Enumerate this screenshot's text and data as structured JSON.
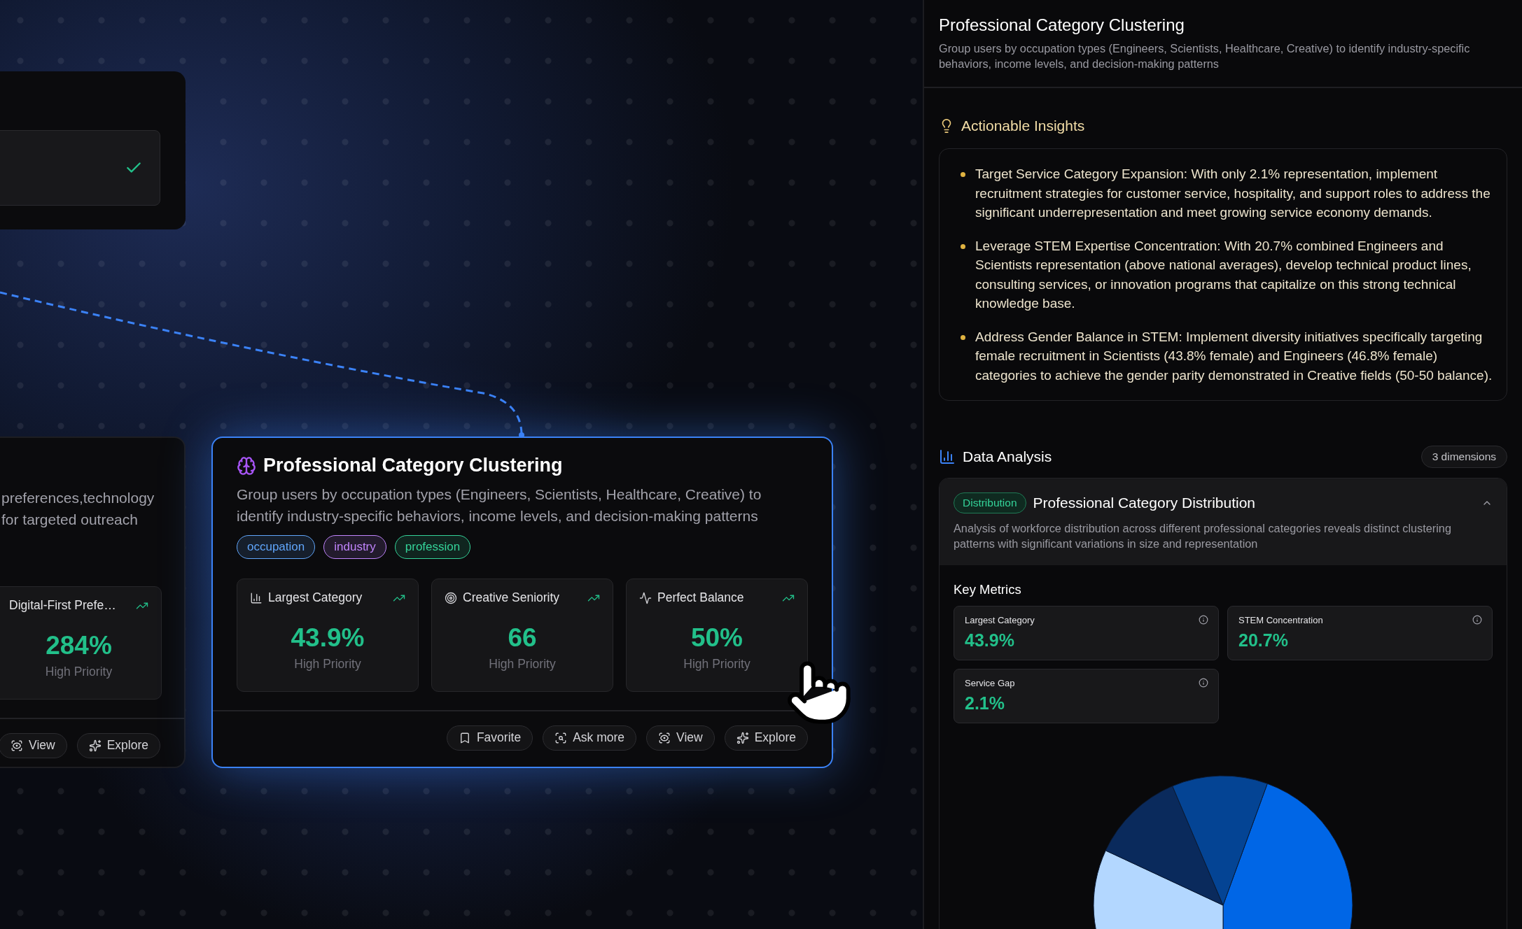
{
  "canvas": {
    "side_card": {
      "selected": false,
      "description_lines": [
        "preferences,technology",
        "for targeted outreach"
      ],
      "metric": {
        "label": "Digital-First Prefe…",
        "value": "284%",
        "priority": "High Priority"
      },
      "actions": [
        {
          "kind": "view",
          "label": "View"
        },
        {
          "kind": "explore",
          "label": "Explore"
        }
      ]
    },
    "main_card": {
      "selected": true,
      "title": "Professional Category Clustering",
      "description": "Group users by occupation types (Engineers, Scientists, Healthcare, Creative) to identify industry-specific behaviors, income levels, and decision-making patterns",
      "tags": [
        {
          "label": "occupation",
          "color": "#60a5fa"
        },
        {
          "label": "industry",
          "color": "#c084fc"
        },
        {
          "label": "profession",
          "color": "#34d399"
        }
      ],
      "metrics": [
        {
          "kind": "chart",
          "label": "Largest Category",
          "value": "43.9%",
          "priority": "High Priority"
        },
        {
          "kind": "target",
          "label": "Creative Seniority",
          "value": "66",
          "priority": "High Priority"
        },
        {
          "kind": "pulse",
          "label": "Perfect Balance",
          "value": "50%",
          "priority": "High Priority"
        }
      ],
      "actions": [
        {
          "kind": "favorite",
          "label": "Favorite"
        },
        {
          "kind": "ask",
          "label": "Ask more"
        },
        {
          "kind": "view",
          "label": "View"
        },
        {
          "kind": "explore",
          "label": "Explore"
        }
      ]
    }
  },
  "panel": {
    "title": "Professional Category Clustering",
    "description": "Group users by occupation types (Engineers, Scientists, Healthcare, Creative) to identify industry-specific behaviors, income levels, and decision-making patterns",
    "insights": {
      "title": "Actionable Insights",
      "items": [
        "Target Service Category Expansion: With only 2.1% representation, implement recruitment strategies for customer service, hospitality, and support roles to address the significant underrepresentation and meet growing service economy demands.",
        "Leverage STEM Expertise Concentration: With 20.7% combined Engineers and Scientists representation (above national averages), develop technical product lines, consulting services, or innovation programs that capitalize on this strong technical knowledge base.",
        "Address Gender Balance in STEM: Implement diversity initiatives specifically targeting female recruitment in Scientists (43.8% female) and Engineers (46.8% female) categories to achieve the gender parity demonstrated in Creative fields (50-50 balance)."
      ]
    },
    "analysis": {
      "title": "Data Analysis",
      "badge": "3 dimensions",
      "section": {
        "tag": "Distribution",
        "title": "Professional Category Distribution",
        "expanded": true,
        "description": "Analysis of workforce distribution across different professional categories reveals distinct clustering patterns with significant variations in size and representation",
        "key_metrics_title": "Key Metrics",
        "metrics": [
          {
            "label": "Largest Category",
            "value": "43.9%"
          },
          {
            "label": "STEM Concentration",
            "value": "20.7%"
          },
          {
            "label": "Service Gap",
            "value": "2.1%"
          }
        ]
      }
    }
  }
}
